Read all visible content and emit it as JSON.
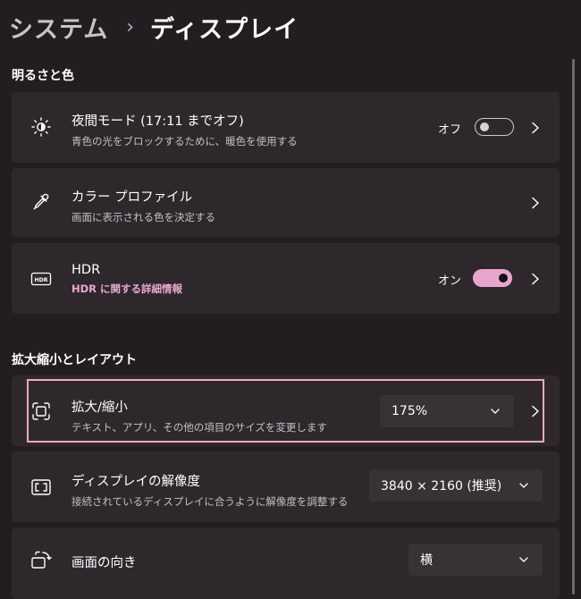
{
  "breadcrumb": {
    "parent": "システム",
    "separator": "›",
    "current": "ディスプレイ"
  },
  "sections": {
    "brightness_color": "明るさと色",
    "scale_layout": "拡大縮小とレイアウト"
  },
  "night_light": {
    "icon": "brightness-sun-icon",
    "title": "夜間モード (17:11 までオフ)",
    "subtitle": "青色の光をブロックするために、暖色を使用する",
    "toggle_label": "オフ",
    "toggle_on": false
  },
  "color_profile": {
    "icon": "eyedropper-icon",
    "title": "カラー プロファイル",
    "subtitle": "画面に表示される色を決定する"
  },
  "hdr": {
    "icon": "hdr-icon",
    "icon_text": "HDR",
    "title": "HDR",
    "link": "HDR に関する詳細情報",
    "toggle_label": "オン",
    "toggle_on": true
  },
  "scale": {
    "icon": "scale-icon",
    "title": "拡大/縮小",
    "subtitle": "テキスト、アプリ、その他の項目のサイズを変更します",
    "value": "175%"
  },
  "resolution": {
    "icon": "resolution-icon",
    "title": "ディスプレイの解像度",
    "subtitle": "接続されているディスプレイに合うように解像度を調整する",
    "value": "3840 × 2160 (推奨)"
  },
  "orientation": {
    "icon": "rotate-screen-icon",
    "title": "画面の向き",
    "value": "横"
  },
  "colors": {
    "accent": "#e6a6cc",
    "highlight_border": "#f2a7bf",
    "card_bg": "#2e282d",
    "page_bg": "#231d22"
  }
}
